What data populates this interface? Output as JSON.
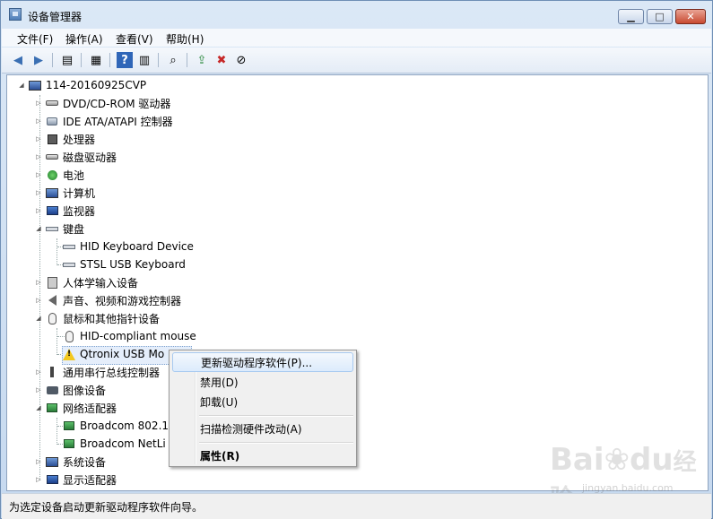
{
  "window": {
    "title": "设备管理器"
  },
  "menubar": [
    "文件(F)",
    "操作(A)",
    "查看(V)",
    "帮助(H)"
  ],
  "tree": [
    {
      "label": "114-20160925CVP",
      "icon": "computer-icon",
      "twisty": "expanded"
    },
    {
      "label": "DVD/CD-ROM 驱动器",
      "icon": "dvd-drive-icon",
      "twisty": "collapsed"
    },
    {
      "label": "IDE ATA/ATAPI 控制器",
      "icon": "ide-controller-icon",
      "twisty": "collapsed"
    },
    {
      "label": "处理器",
      "icon": "processor-icon",
      "twisty": "collapsed"
    },
    {
      "label": "磁盘驱动器",
      "icon": "disk-drive-icon",
      "twisty": "collapsed"
    },
    {
      "label": "电池",
      "icon": "battery-icon",
      "twisty": "collapsed"
    },
    {
      "label": "计算机",
      "icon": "computer-icon",
      "twisty": "collapsed"
    },
    {
      "label": "监视器",
      "icon": "monitor-icon",
      "twisty": "collapsed"
    },
    {
      "label": "键盘",
      "icon": "keyboard-icon",
      "twisty": "expanded"
    },
    {
      "label": "HID Keyboard Device",
      "icon": "keyboard-icon",
      "twisty": "none"
    },
    {
      "label": "STSL USB Keyboard",
      "icon": "keyboard-icon",
      "twisty": "none"
    },
    {
      "label": "人体学输入设备",
      "icon": "hid-icon",
      "twisty": "collapsed"
    },
    {
      "label": "声音、视频和游戏控制器",
      "icon": "sound-icon",
      "twisty": "collapsed"
    },
    {
      "label": "鼠标和其他指针设备",
      "icon": "mouse-icon",
      "twisty": "expanded"
    },
    {
      "label": "HID-compliant mouse",
      "icon": "mouse-icon",
      "twisty": "none"
    },
    {
      "label": "Qtronix USB Mo",
      "icon": "warning-icon",
      "twisty": "none"
    },
    {
      "label": "通用串行总线控制器",
      "icon": "usb-icon",
      "twisty": "collapsed"
    },
    {
      "label": "图像设备",
      "icon": "camera-icon",
      "twisty": "collapsed"
    },
    {
      "label": "网络适配器",
      "icon": "network-icon",
      "twisty": "expanded"
    },
    {
      "label": "Broadcom 802.1",
      "icon": "network-icon",
      "twisty": "none"
    },
    {
      "label": "Broadcom NetLi",
      "icon": "network-icon",
      "twisty": "none"
    },
    {
      "label": "系统设备",
      "icon": "system-icon",
      "twisty": "collapsed"
    },
    {
      "label": "显示适配器",
      "icon": "display-adapter-icon",
      "twisty": "collapsed"
    }
  ],
  "context_menu": {
    "update": "更新驱动程序软件(P)...",
    "disable": "禁用(D)",
    "uninstall": "卸载(U)",
    "scan": "扫描检测硬件改动(A)",
    "properties": "属性(R)"
  },
  "status": "为选定设备启动更新驱动程序软件向导。",
  "watermark": {
    "main": "Bai",
    "mid": "du",
    "cn": "经验",
    "sub": "jingyan.baidu.com"
  }
}
